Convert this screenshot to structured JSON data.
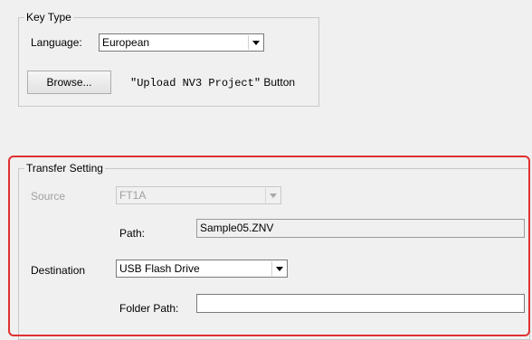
{
  "key_type": {
    "title": "Key Type",
    "language_label": "Language:",
    "language_value": "European",
    "browse_label": "Browse...",
    "upload_caption_mono": "\"Upload NV3 Project\"",
    "upload_caption_suffix": " Button"
  },
  "transfer_setting": {
    "title": "Transfer Setting",
    "source_label": "Source",
    "source_value": "FT1A",
    "path_label": "Path:",
    "path_value": "Sample05.ZNV",
    "destination_label": "Destination",
    "destination_value": "USB Flash Drive",
    "folder_path_label": "Folder Path:",
    "folder_path_value": ""
  },
  "colors": {
    "highlight": "#e03131",
    "window_bg": "#f0f0f0"
  }
}
